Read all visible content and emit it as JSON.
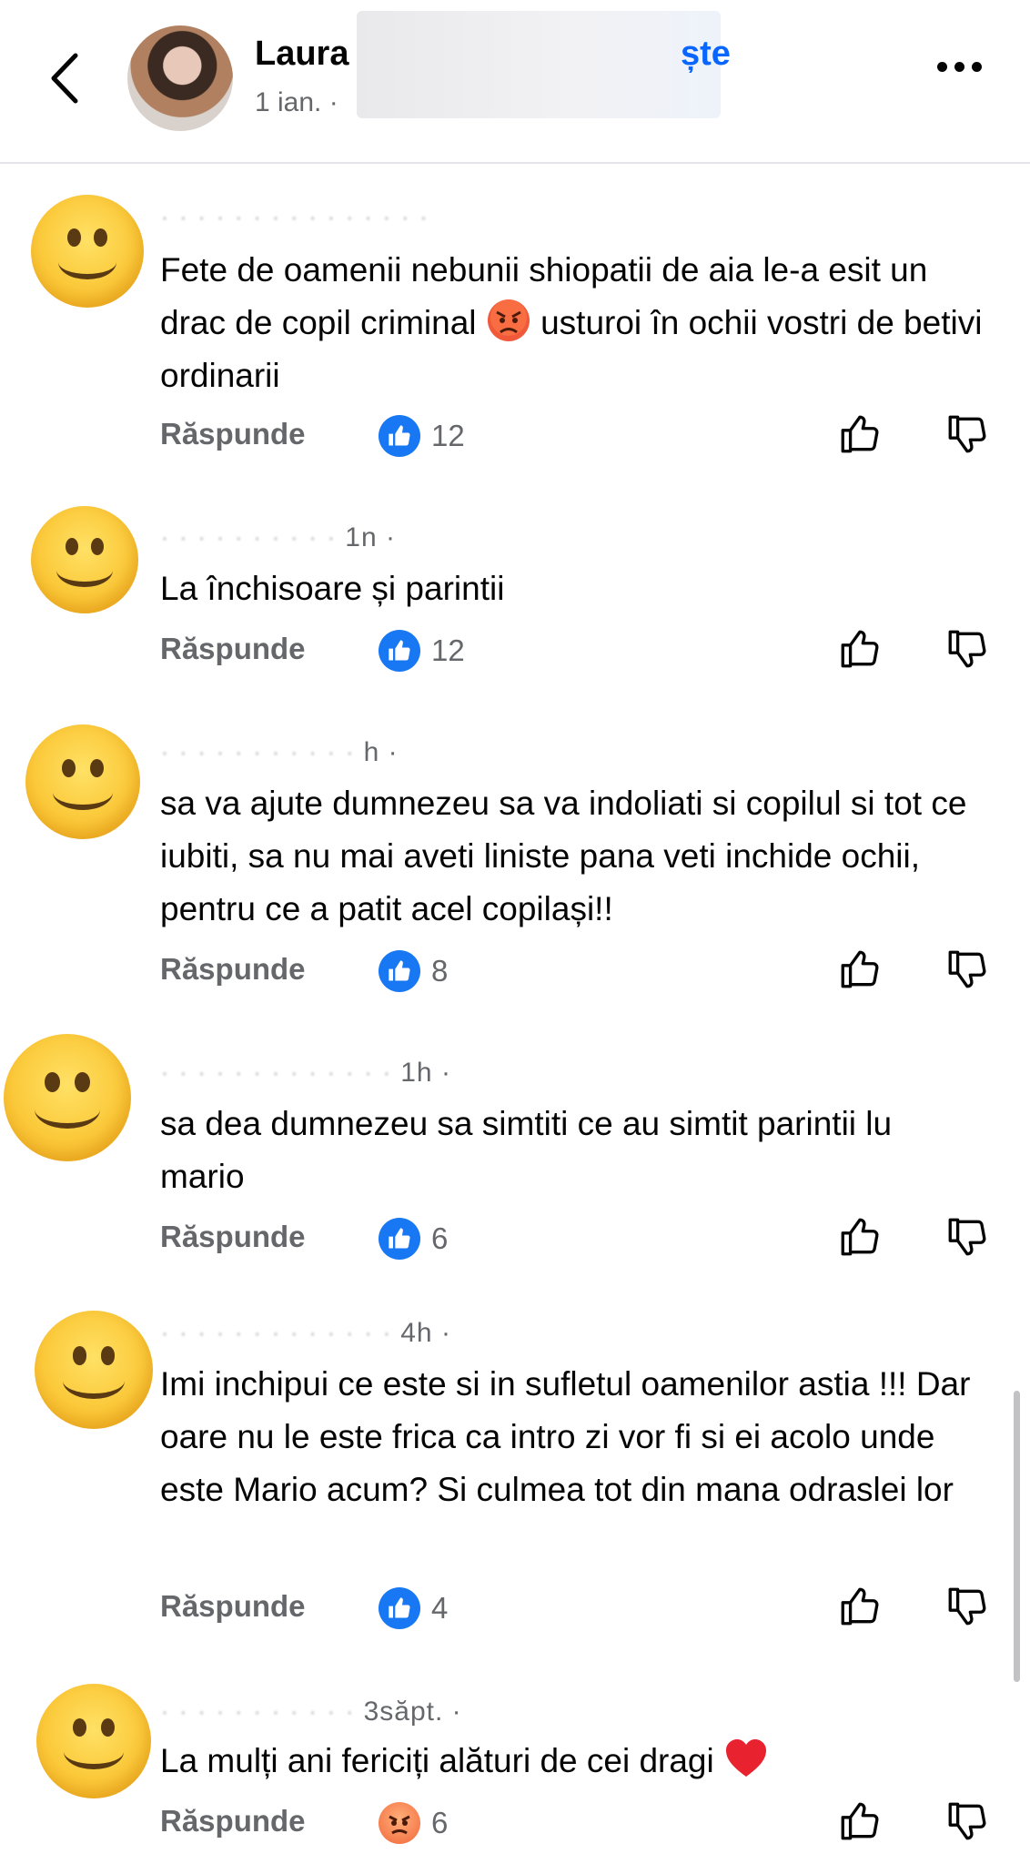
{
  "header": {
    "name": "Laura",
    "time": "1 ian. ·",
    "follow_suffix": "ște"
  },
  "comments": [
    {
      "author": "",
      "time": "",
      "text_before": "Fete de oamenii nebunii shiopatii de aia le-a esit un drac de copil criminal ",
      "emoji": "angry-face",
      "text_after": " usturoi în ochii vostri de betivi ordinarii",
      "reply": "Răspunde",
      "reaction": "like",
      "count": "12"
    },
    {
      "author": "",
      "time": "1n ·",
      "text": "La închisoare și parintii",
      "reply": "Răspunde",
      "reaction": "like",
      "count": "12"
    },
    {
      "author": "",
      "time": "h ·",
      "text": "sa va ajute dumnezeu sa va indoliati si copilul si tot ce iubiti, sa nu mai aveti liniste pana veti inchide ochii, pentru ce a patit acel copilași!!",
      "reply": "Răspunde",
      "reaction": "like",
      "count": "8"
    },
    {
      "author": "",
      "time": "1h ·",
      "text": "sa dea dumnezeu sa simtiti ce au simtit parintii lu mario",
      "reply": "Răspunde",
      "reaction": "like",
      "count": "6"
    },
    {
      "author": "",
      "time": "4h ·",
      "text": "Imi inchipui ce este si in sufletul oamenilor astia !!! Dar oare nu le este frica ca intro zi vor fi si ei acolo unde este Mario acum? Si culmea tot din mana odraslei lor",
      "reply": "Răspunde",
      "reaction": "like",
      "count": "4"
    },
    {
      "author": "",
      "time": "3săpt. ·",
      "text": "La mulți ani fericiți alături de cei dragi ",
      "emoji": "red-heart",
      "reply": "Răspunde",
      "reaction": "angry",
      "count": "6"
    }
  ],
  "colors": {
    "like_blue": "#1877f2",
    "secondary_text": "#65676b",
    "follow_blue": "#0866ff"
  }
}
